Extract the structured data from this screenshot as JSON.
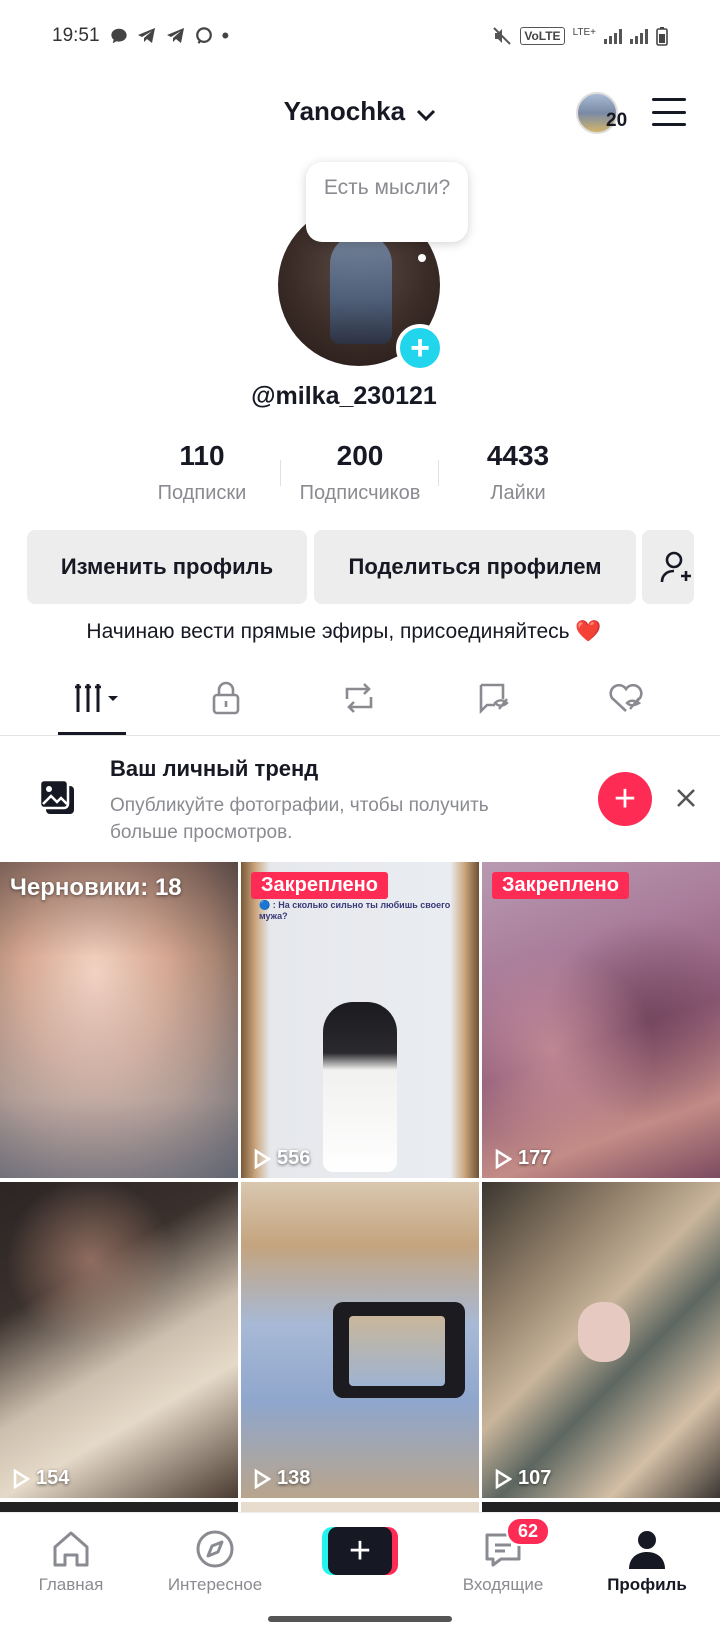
{
  "status_bar": {
    "time": "19:51",
    "network": "VoLTE",
    "lte": "LTE+"
  },
  "header": {
    "title": "Yanochka",
    "story_count": "20"
  },
  "profile": {
    "bubble_text": "Есть мысли?",
    "handle": "@milka_230121",
    "stats": [
      {
        "value": "110",
        "label": "Подписки"
      },
      {
        "value": "200",
        "label": "Подписчиков"
      },
      {
        "value": "4433",
        "label": "Лайки"
      }
    ],
    "edit_label": "Изменить профиль",
    "share_label": "Поделиться профилем",
    "bio": "Начинаю вести прямые эфиры, присоединяйтесь ❤️"
  },
  "tabs": [
    "videos-icon",
    "lock-icon",
    "repost-icon",
    "favorites-icon",
    "liked-icon"
  ],
  "trend": {
    "title": "Ваш личный тренд",
    "subtitle": "Опубликуйте фотографии, чтобы получить больше просмотров."
  },
  "grid": {
    "drafts_label": "Черновики: 18",
    "pinned_label": "Закреплено",
    "caption": "🔵 : На сколько сильно ты любишь своего мужа?",
    "views": [
      "556",
      "177",
      "154",
      "138",
      "107"
    ]
  },
  "nav": {
    "home": "Главная",
    "discover": "Интересное",
    "inbox": "Входящие",
    "inbox_badge": "62",
    "profile": "Профиль"
  },
  "colors": {
    "accent": "#fe2c55",
    "cyan": "#20d5ec"
  }
}
